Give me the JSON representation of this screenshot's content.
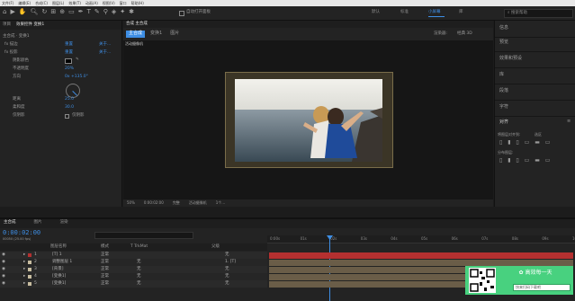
{
  "menu": [
    "文件(F)",
    "编辑(E)",
    "合成(C)",
    "图层(L)",
    "效果(T)",
    "动画(A)",
    "视图(V)",
    "窗口",
    "帮助(H)"
  ],
  "toolbar": {
    "auto_open": "自动打开面板",
    "workspaces": [
      "默认",
      "标准",
      "小屏幕",
      "库"
    ],
    "active_workspace": "小屏幕",
    "search_placeholder": "搜索帮助"
  },
  "effects": {
    "tabs": [
      "项目",
      "效果控件 变换1"
    ],
    "layer_path": "主合成 · 变换1",
    "rows": [
      {
        "label": "fx 描边",
        "value": "重置",
        "extra": "关于..."
      },
      {
        "label": "fx 投影",
        "value": "重置",
        "extra": "关于..."
      },
      {
        "label": "阴影颜色",
        "value": ""
      },
      {
        "label": "不透明度",
        "value": "20%"
      },
      {
        "label": "方向",
        "value": "0x +135.0°"
      },
      {
        "label": "距离",
        "value": "25.0"
      },
      {
        "label": "柔和度",
        "value": "30.0"
      },
      {
        "label": "仅阴影",
        "value": "仅阴影"
      }
    ]
  },
  "composition": {
    "tab_label": "合成 主合成",
    "sub_tabs": [
      "主合成",
      "变换1",
      "图片"
    ],
    "renderer_label": "渲染器:",
    "renderer_value": "经典 3D",
    "status": "活动摄像机",
    "zoom": "50%",
    "timecode": "0:00:02:00",
    "quality": "完整",
    "camera": "活动摄像机",
    "views": "1个..."
  },
  "right_panel": {
    "items": [
      "信息",
      "预览",
      "效果和预设",
      "库",
      "段落",
      "字符",
      "对齐"
    ],
    "align_label": "将图层对齐到:",
    "align_target": "选区",
    "distribute_label": "分布图层:"
  },
  "timeline": {
    "tabs": [
      "主合成",
      "图片",
      "渲染"
    ],
    "timecode": "0:00:02:00",
    "timecode_sub": "00050 (25.00 fps)",
    "search_placeholder": "",
    "columns": {
      "name": "图层名称",
      "mode": "模式",
      "trkmat": "T TrkMat",
      "parent": "父级"
    },
    "ruler": [
      "0:00s",
      "01s",
      "02s",
      "03s",
      "04s",
      "05s",
      "06s",
      "07s",
      "08s",
      "09s",
      "10s"
    ],
    "layers": [
      {
        "num": "1",
        "name": "[T] 1",
        "mode": "正常",
        "trk": "",
        "parent": "无",
        "color": "#b43030"
      },
      {
        "num": "2",
        "name": "调整图层 1",
        "mode": "正常",
        "trk": "无",
        "parent": "1. [T]",
        "color": "#c8bda0"
      },
      {
        "num": "3",
        "name": "[背景]",
        "mode": "正常",
        "trk": "无",
        "parent": "无",
        "color": "#c8bda0"
      },
      {
        "num": "4",
        "name": "[变换1]",
        "mode": "正常",
        "trk": "无",
        "parent": "无",
        "color": "#c8bda0"
      },
      {
        "num": "5",
        "name": "[变换1]",
        "mode": "正常",
        "trk": "无",
        "parent": "无",
        "color": "#c8bda0"
      }
    ]
  },
  "ad": {
    "button": "高效每一天",
    "input": "快来扫码下载吧"
  },
  "colors": {
    "accent": "#3e8ee4",
    "panel": "#232323",
    "ad_green": "#48d17f",
    "bar_red": "#b43030",
    "bar_tan": "#6a5d48"
  }
}
